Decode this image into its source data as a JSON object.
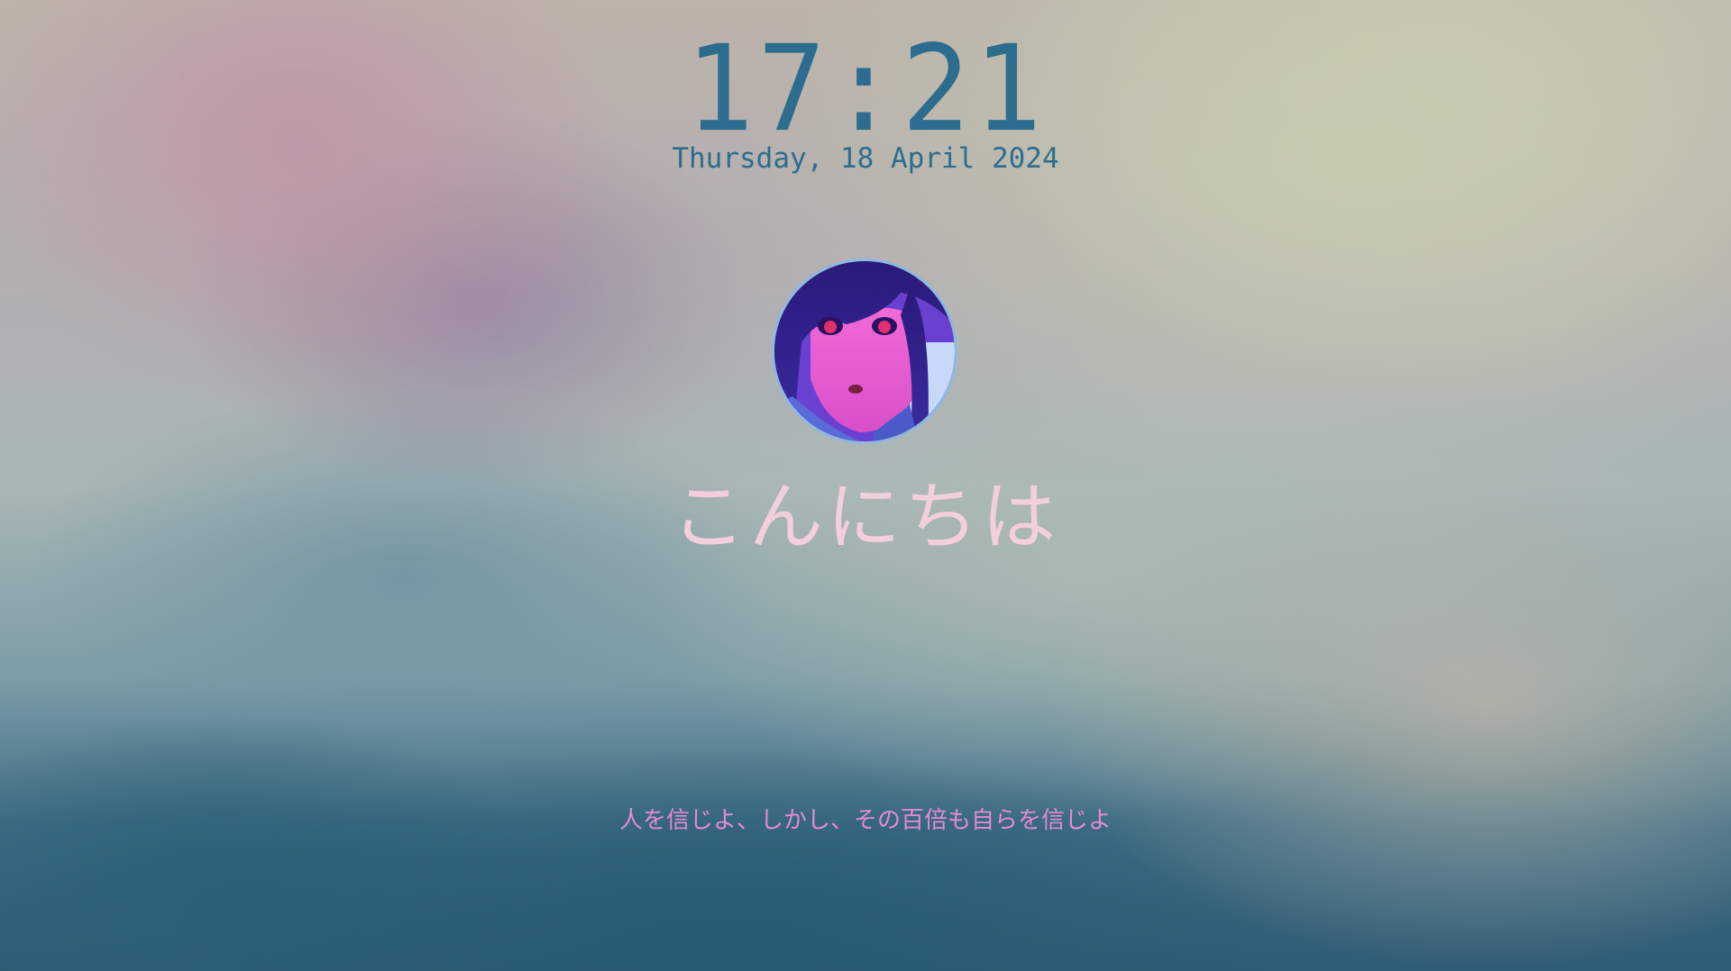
{
  "lockscreen": {
    "time": "17:21",
    "date": "Thursday, 18 April 2024",
    "greeting": "こんにちは",
    "quote": "人を信じよ、しかし、その百倍も自らを信じよ"
  },
  "avatar": {
    "icon": "user-avatar-anime-portrait"
  },
  "colors": {
    "clock": "#2c6d8f",
    "greeting": "#f3cfdc",
    "quote": "#e48ad4",
    "avatar_border": "#8fb8e0"
  }
}
